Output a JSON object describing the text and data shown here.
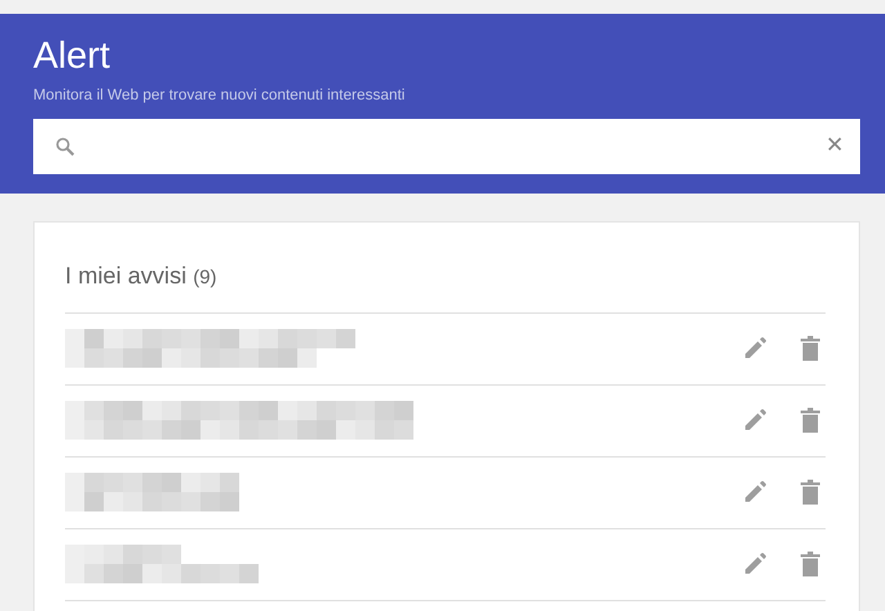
{
  "header": {
    "title": "Alert",
    "subtitle": "Monitora il Web per trovare nuovi contenuti interessanti"
  },
  "search": {
    "clear": "✕"
  },
  "alerts_panel": {
    "heading": "I miei avvisi",
    "count": "(9)"
  },
  "alerts": [
    {
      "kind": "redacted"
    },
    {
      "kind": "redacted"
    },
    {
      "kind": "redacted"
    },
    {
      "kind": "redacted"
    }
  ]
}
